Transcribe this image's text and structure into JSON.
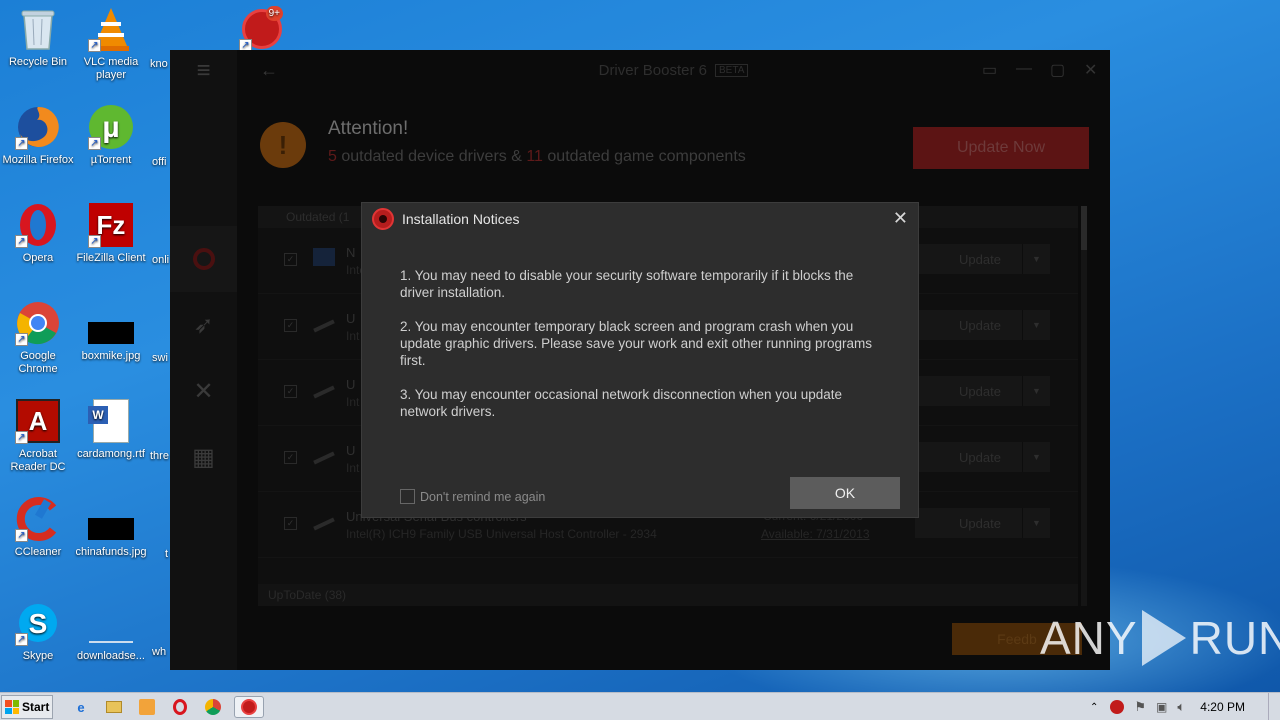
{
  "desktop": {
    "icons": [
      {
        "label": "Recycle Bin",
        "icon": "recycle-bin-icon"
      },
      {
        "label": "VLC media player",
        "icon": "vlc-icon"
      },
      {
        "label": "Mozilla Firefox",
        "icon": "firefox-icon"
      },
      {
        "label": "µTorrent",
        "icon": "utorrent-icon"
      },
      {
        "label": "Opera",
        "icon": "opera-icon"
      },
      {
        "label": "FileZilla Client",
        "icon": "filezilla-icon"
      },
      {
        "label": "Google Chrome",
        "icon": "chrome-icon"
      },
      {
        "label": "boxmike.jpg",
        "icon": "image-file-icon"
      },
      {
        "label": "Acrobat Reader DC",
        "icon": "acrobat-icon"
      },
      {
        "label": "cardamong.rtf",
        "icon": "rtf-file-icon"
      },
      {
        "label": "CCleaner",
        "icon": "ccleaner-icon"
      },
      {
        "label": "chinafunds.jpg",
        "icon": "image-file-icon"
      },
      {
        "label": "Skype",
        "icon": "skype-icon"
      },
      {
        "label": "downloadse...",
        "icon": "file-icon"
      }
    ],
    "partial_labels": [
      "kno",
      "offi",
      "onli",
      "swi",
      "thre",
      "t",
      "wh"
    ]
  },
  "app": {
    "title": "Driver Booster 6",
    "badge": "BETA",
    "attention_title": "Attention!",
    "outdated_count": "5",
    "outdated_text": " outdated device drivers & ",
    "game_count": "11",
    "game_text": " outdated game components",
    "update_now_label": "Update Now",
    "list_header": "Outdated (1",
    "rows": [
      {
        "name": "N",
        "sub": "Inte",
        "current": "",
        "available": "",
        "update": "Update"
      },
      {
        "name": "U",
        "sub": "Int",
        "current": "",
        "available": "",
        "update": "Update"
      },
      {
        "name": "U",
        "sub": "Int",
        "current": "",
        "available": "",
        "update": "Update"
      },
      {
        "name": "U",
        "sub": "Int",
        "current": "",
        "available": "",
        "update": "Update"
      },
      {
        "name": "Universal Serial Bus controllers",
        "sub": "Intel(R) ICH9 Family USB Universal Host Controller - 2934",
        "current": "Current: 6/21/2006",
        "available": "Available: 7/31/2013",
        "update": "Update"
      }
    ],
    "uptodate_label": "UpToDate (38)",
    "feedback_label": "Feedb"
  },
  "dialog": {
    "title": "Installation Notices",
    "notice1": "1. You may need to disable your security software temporarily if it blocks the driver installation.",
    "notice2": "2. You may encounter temporary black screen and program crash when you update graphic drivers. Please save your work and exit other running programs first.",
    "notice3": "3. You may encounter occasional network disconnection when you update network drivers.",
    "remind_label": "Don't remind me again",
    "ok_label": "OK"
  },
  "watermark": {
    "left": "ANY",
    "right": "RUN"
  },
  "taskbar": {
    "start_label": "Start",
    "clock": "4:20 PM"
  }
}
